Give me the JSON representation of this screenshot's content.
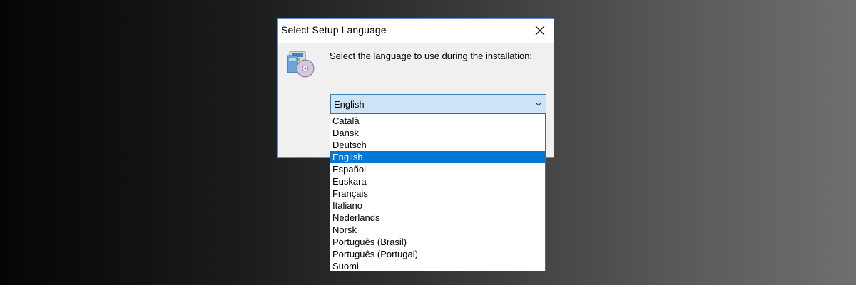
{
  "dialog": {
    "title": "Select Setup Language",
    "prompt": "Select the language to use during the installation:",
    "icons": {
      "close": "close-icon",
      "setup": "setup-cd-icon",
      "dropdown_arrow": "chevron-down-icon"
    }
  },
  "language_select": {
    "selected": "English",
    "options": [
      "Català",
      "Dansk",
      "Deutsch",
      "English",
      "Español",
      "Euskara",
      "Français",
      "Italiano",
      "Nederlands",
      "Norsk",
      "Português (Brasil)",
      "Português (Portugal)",
      "Suomi"
    ],
    "highlighted_index": 3
  },
  "colors": {
    "selection": "#0078d7",
    "combo_fill": "#cce4f7",
    "combo_border": "#3c7fb1",
    "window_border": "#5a8ed0"
  }
}
